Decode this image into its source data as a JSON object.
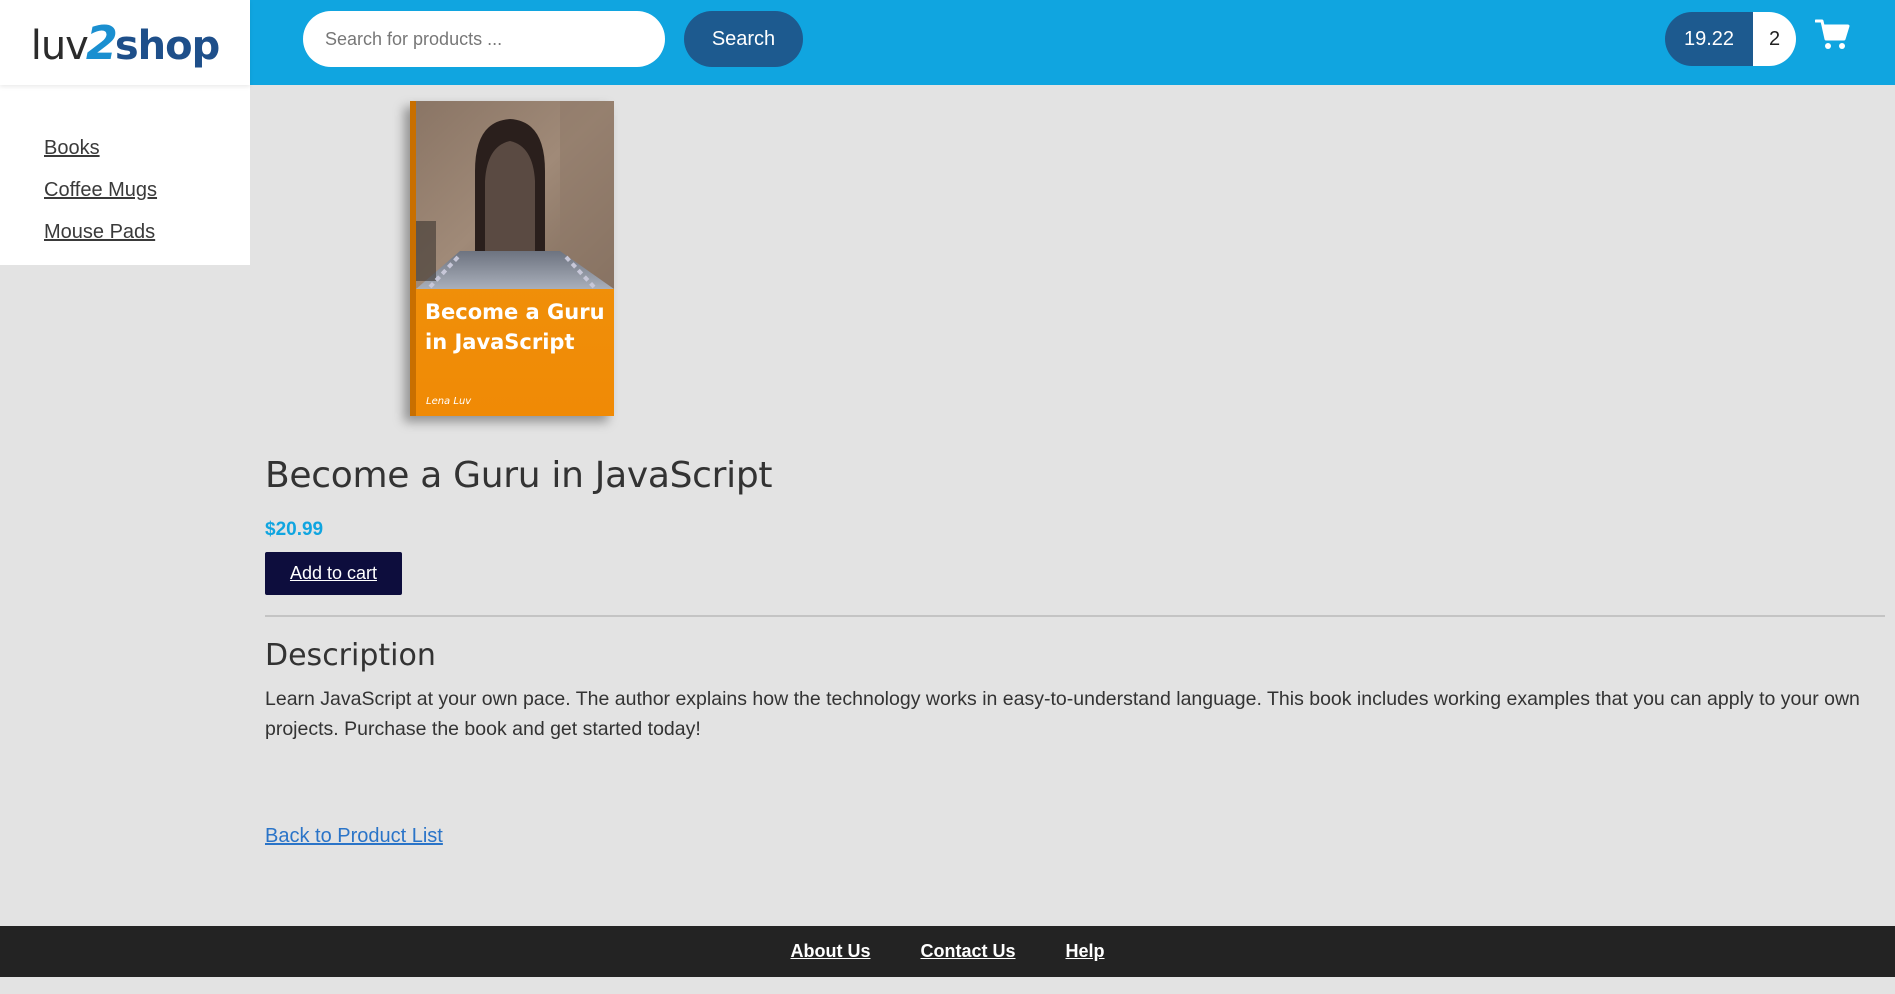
{
  "brand": {
    "logo_part1": "luv",
    "logo_part2": "2",
    "logo_part3": "shop"
  },
  "sidebar": {
    "items": [
      {
        "label": "Books"
      },
      {
        "label": "Coffee Mugs"
      },
      {
        "label": "Mouse Pads"
      }
    ]
  },
  "header": {
    "search_placeholder": "Search for products ...",
    "search_button": "Search",
    "cart_total": "19.22",
    "cart_quantity": "2",
    "cart_icon": "shopping-cart-icon"
  },
  "product": {
    "cover": {
      "title_line1": "Become a Guru",
      "title_line2": "in JavaScript",
      "author": "Lena Luv"
    },
    "name": "Become a Guru in JavaScript",
    "price": "$20.99",
    "add_to_cart": "Add to cart",
    "description_heading": "Description",
    "description": "Learn JavaScript at your own pace. The author explains how the technology works in easy-to-understand language. This book includes working examples that you can apply to your own projects. Purchase the book and get started today!",
    "back_link": "Back to Product List"
  },
  "footer": {
    "links": [
      {
        "label": "About Us"
      },
      {
        "label": "Contact Us"
      },
      {
        "label": "Help"
      }
    ]
  },
  "colors": {
    "header_bg": "#10a5e0",
    "button_dark": "#1d5a8f",
    "price": "#10a5e0",
    "add_button": "#0d0d3d",
    "footer_bg": "#232323",
    "link": "#2a74c8"
  }
}
